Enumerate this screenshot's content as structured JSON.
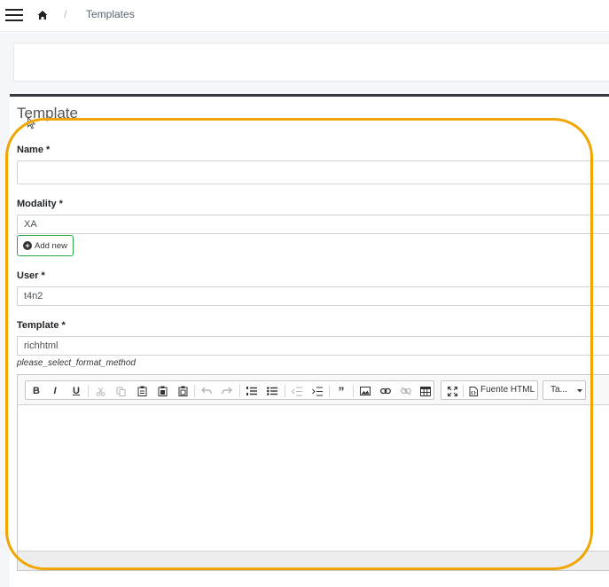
{
  "breadcrumb": {
    "separator": "/",
    "current": "Templates"
  },
  "card": {
    "title": "Template"
  },
  "form": {
    "name": {
      "label": "Name *",
      "value": ""
    },
    "modality": {
      "label": "Modality *",
      "value": "XA",
      "add_label": "Add new"
    },
    "user": {
      "label": "User *",
      "value": "t4n2"
    },
    "template": {
      "label": "Template *",
      "value": "richhtml",
      "hint": "please_select_format_method"
    }
  },
  "editor": {
    "toolbar": {
      "bold": "B",
      "italic": "I",
      "underline": "U",
      "source_label": "Fuente HTML",
      "table_dropdown_label": "Ta..."
    }
  },
  "colors": {
    "highlight": "#f0a500",
    "add_button_border": "#28a745",
    "card_top_border": "#343a40"
  }
}
